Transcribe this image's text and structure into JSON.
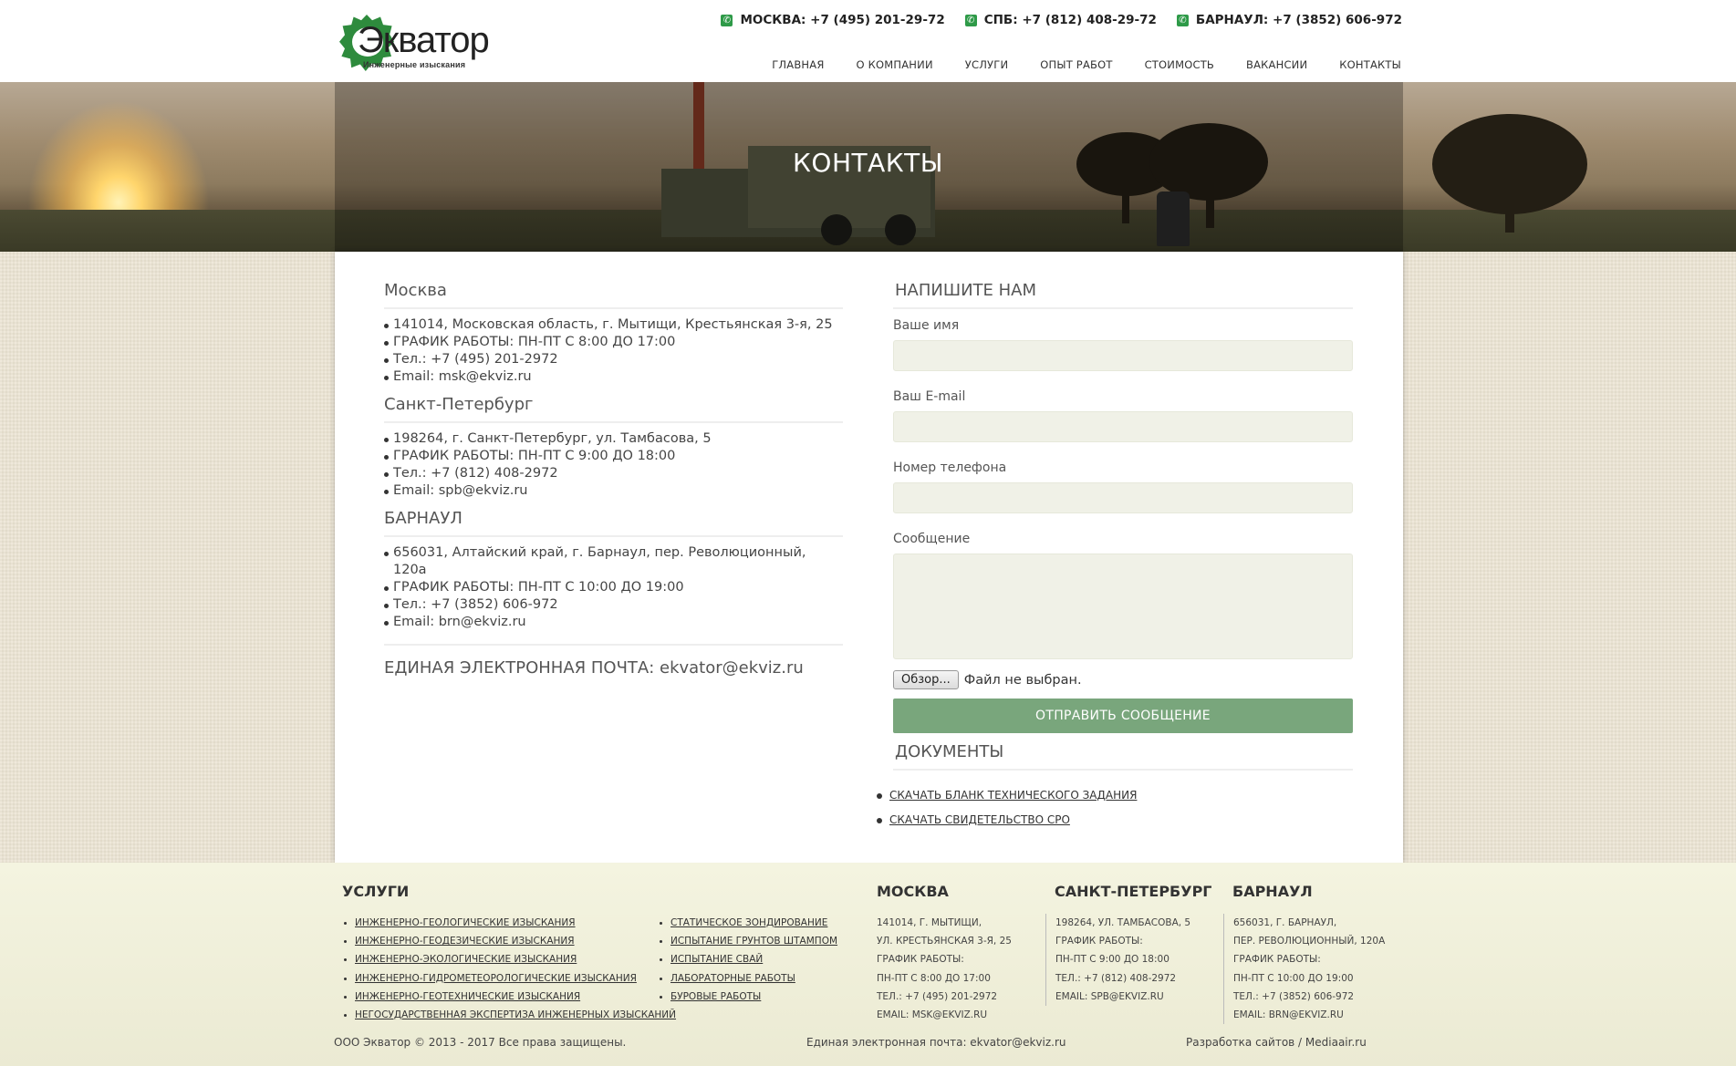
{
  "header": {
    "logo_name": "Экватор",
    "logo_tagline": "Инженерные изыскания",
    "phones": [
      {
        "label": "МОСКВА: +7 (495) 201-29-72"
      },
      {
        "label": "СПБ: +7 (812) 408-29-72"
      },
      {
        "label": "БАРНАУЛ: +7 (3852) 606-972"
      }
    ],
    "nav": [
      "ГЛАВНАЯ",
      "О КОМПАНИИ",
      "УСЛУГИ",
      "ОПЫТ РАБОТ",
      "СТОИМОСТЬ",
      "ВАКАНСИИ",
      "КОНТАКТЫ"
    ]
  },
  "banner": {
    "title": "КОНТАКТЫ"
  },
  "offices": [
    {
      "city": "Москва",
      "lines": [
        "141014, Московская область, г. Мытищи, Крестьянская 3-я, 25",
        "ГРАФИК РАБОТЫ: ПН-ПТ С 8:00 ДО 17:00",
        "Тел.: +7 (495) 201-2972",
        "Email: msk@ekviz.ru"
      ]
    },
    {
      "city": "Санкт-Петербург",
      "lines": [
        "198264, г. Санкт-Петербург, ул. Тамбасова, 5",
        "ГРАФИК РАБОТЫ: ПН-ПТ С 9:00 ДО 18:00",
        "Тел.: +7 (812) 408-2972",
        "Email: spb@ekviz.ru"
      ]
    },
    {
      "city": "БАРНАУЛ",
      "lines": [
        "656031, Алтайский край, г. Барнаул, пер. Революционный, 120а",
        "ГРАФИК РАБОТЫ: ПН-ПТ С 10:00 ДО 19:00",
        "Тел.: +7 (3852) 606-972",
        "Email: brn@ekviz.ru"
      ]
    }
  ],
  "common_email": "ЕДИНАЯ ЭЛЕКТРОННАЯ ПОЧТА: ekvator@ekviz.ru",
  "form": {
    "title": "НАПИШИТЕ НАМ",
    "name_label": "Ваше имя",
    "email_label": "Ваш E-mail",
    "phone_label": "Номер телефона",
    "message_label": "Сообщение",
    "file_button": "Обзор...",
    "file_status": "Файл не выбран.",
    "submit": "ОТПРАВИТЬ СООБЩЕНИЕ"
  },
  "documents": {
    "title": "ДОКУМЕНТЫ",
    "links": [
      "СКАЧАТЬ БЛАНК ТЕХНИЧЕСКОГО ЗАДАНИЯ",
      "СКАЧАТЬ СВИДЕТЕЛЬСТВО СРО"
    ]
  },
  "footer": {
    "services_title": "УСЛУГИ",
    "services_col1": [
      "ИНЖЕНЕРНО-ГЕОЛОГИЧЕСКИЕ ИЗЫСКАНИЯ",
      "ИНЖЕНЕРНО-ГЕОДЕЗИЧЕСКИЕ ИЗЫСКАНИЯ",
      "ИНЖЕНЕРНО-ЭКОЛОГИЧЕСКИЕ ИЗЫСКАНИЯ",
      "ИНЖЕНЕРНО-ГИДРОМЕТЕОРОЛОГИЧЕСКИЕ ИЗЫСКАНИЯ",
      "ИНЖЕНЕРНО-ГЕОТЕХНИЧЕСКИЕ ИЗЫСКАНИЯ",
      "НЕГОСУДАРСТВЕННАЯ ЭКСПЕРТИЗА ИНЖЕНЕРНЫХ ИЗЫСКАНИЙ"
    ],
    "services_col2": [
      "СТАТИЧЕСКОЕ ЗОНДИРОВАНИЕ",
      "ИСПЫТАНИЕ ГРУНТОВ ШТАМПОМ",
      "ИСПЫТАНИЕ СВАЙ",
      "ЛАБОРАТОРНЫЕ РАБОТЫ",
      "БУРОВЫЕ РАБОТЫ"
    ],
    "cities": [
      {
        "title": "МОСКВА",
        "lines": [
          "141014, Г. МЫТИЩИ,",
          "УЛ. КРЕСТЬЯНСКАЯ 3-Я, 25",
          "ГРАФИК РАБОТЫ:",
          "ПН-ПТ С 8:00 ДО 17:00",
          "ТЕЛ.: +7 (495) 201-2972",
          "EMAIL: MSK@EKVIZ.RU"
        ]
      },
      {
        "title": "САНКТ-ПЕТЕРБУРГ",
        "lines": [
          "198264, УЛ. ТАМБАСОВА, 5",
          "ГРАФИК РАБОТЫ:",
          "ПН-ПТ С 9:00 ДО 18:00",
          "ТЕЛ.: +7 (812) 408-2972",
          "EMAIL: SPB@EKVIZ.RU"
        ]
      },
      {
        "title": "БАРНАУЛ",
        "lines": [
          "656031, Г. БАРНАУЛ,",
          "ПЕР. РЕВОЛЮЦИОННЫЙ, 120А",
          "ГРАФИК РАБОТЫ:",
          "ПН-ПТ С 10:00 ДО 19:00",
          "ТЕЛ.: +7 (3852) 606-972",
          "EMAIL: BRN@EKVIZ.RU"
        ]
      }
    ],
    "copyright": "ООО Экватор © 2013 - 2017 Все права защищены.",
    "common_email": "Единая электронная почта: ekvator@ekviz.ru",
    "developer": "Разработка сайтов / Mediaair.ru"
  }
}
